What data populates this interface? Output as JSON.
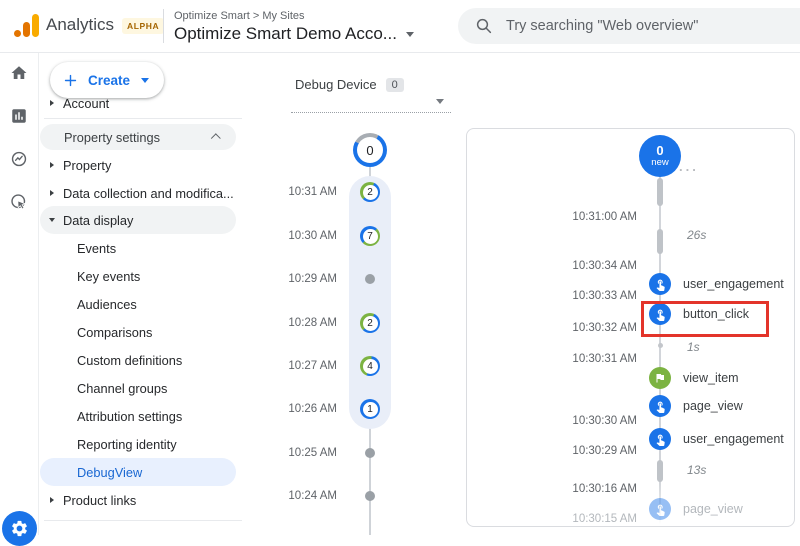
{
  "header": {
    "product": "Analytics",
    "alpha_badge": "ALPHA",
    "breadcrumb": "Optimize Smart > My Sites",
    "account_selector": "Optimize Smart Demo Acco...",
    "search_placeholder": "Try searching \"Web overview\""
  },
  "nav": {
    "create_label": "Create",
    "account_item": "Account",
    "section_header": "Property settings",
    "items": {
      "property": "Property",
      "data_collection": "Data collection and modifica...",
      "data_display": "Data display",
      "events": "Events",
      "key_events": "Key events",
      "audiences": "Audiences",
      "comparisons": "Comparisons",
      "custom_definitions": "Custom definitions",
      "channel_groups": "Channel groups",
      "attribution_settings": "Attribution settings",
      "reporting_identity": "Reporting identity",
      "debugview": "DebugView",
      "product_links": "Product links"
    }
  },
  "debug_panel": {
    "device_label": "Debug Device",
    "device_count": "0",
    "top_count": "0",
    "minutes": [
      {
        "time": "10:31 AM",
        "count": "2"
      },
      {
        "time": "10:30 AM",
        "count": "7"
      },
      {
        "time": "10:29 AM",
        "count": ""
      },
      {
        "time": "10:28 AM",
        "count": "2"
      },
      {
        "time": "10:27 AM",
        "count": "4"
      },
      {
        "time": "10:26 AM",
        "count": "1"
      },
      {
        "time": "10:25 AM",
        "count": ""
      },
      {
        "time": "10:24 AM",
        "count": ""
      }
    ]
  },
  "stream": {
    "head_count": "0",
    "head_label": "new",
    "truncated_marker": "...",
    "timestamps": [
      "10:31:00 AM",
      "10:30:34 AM",
      "10:30:33 AM",
      "10:30:32 AM",
      "10:30:31 AM",
      "10:30:30 AM",
      "10:30:29 AM",
      "10:30:16 AM",
      "10:30:15 AM"
    ],
    "durations": [
      "26s",
      "1s",
      "13s"
    ],
    "events": [
      {
        "name": "user_engagement"
      },
      {
        "name": "button_click",
        "highlighted": true
      },
      {
        "name": "view_item",
        "key_event": true
      },
      {
        "name": "page_view"
      },
      {
        "name": "user_engagement"
      },
      {
        "name": "page_view",
        "faded": true
      }
    ]
  },
  "colors": {
    "accent_blue": "#1a73e8",
    "key_event_green": "#7cb342",
    "annotation_red": "#e3342a",
    "selected_nav_bg": "#e8f0fe",
    "band_bg": "#e9eef8",
    "logo_orange": "#f9ab00",
    "logo_dark_orange": "#e37400"
  }
}
